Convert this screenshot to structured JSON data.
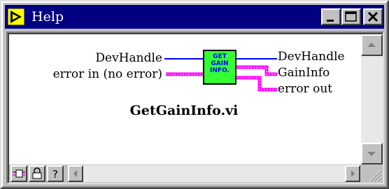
{
  "window": {
    "title": "Help",
    "icon": "labview-help-icon",
    "colors": {
      "titlebar": "#000080",
      "face": "#c0c0c0"
    }
  },
  "title_buttons": [
    {
      "name": "minimize-button",
      "icon": "minimize-icon"
    },
    {
      "name": "maximize-button",
      "icon": "maximize-icon"
    },
    {
      "name": "close-button",
      "icon": "close-icon"
    }
  ],
  "diagram": {
    "inputs": [
      "DevHandle",
      "error in (no error)"
    ],
    "outputs": [
      "DevHandle",
      "GainInfo",
      "error out"
    ],
    "node_label": [
      "GET",
      "GAIN",
      "INFO."
    ],
    "vi_name": "GetGainInfo.vi",
    "colors": {
      "node_fill": "#33ff33",
      "node_text": "#0000ff",
      "refnum_wire": "#0000ff",
      "cluster_wire": "#ff00ff"
    }
  },
  "bottom_buttons": [
    {
      "name": "simple-diagram-help-button",
      "icon": "diagram-help-icon"
    },
    {
      "name": "lock-help-button",
      "icon": "lock-icon"
    },
    {
      "name": "online-help-button",
      "icon": "question-icon"
    }
  ]
}
